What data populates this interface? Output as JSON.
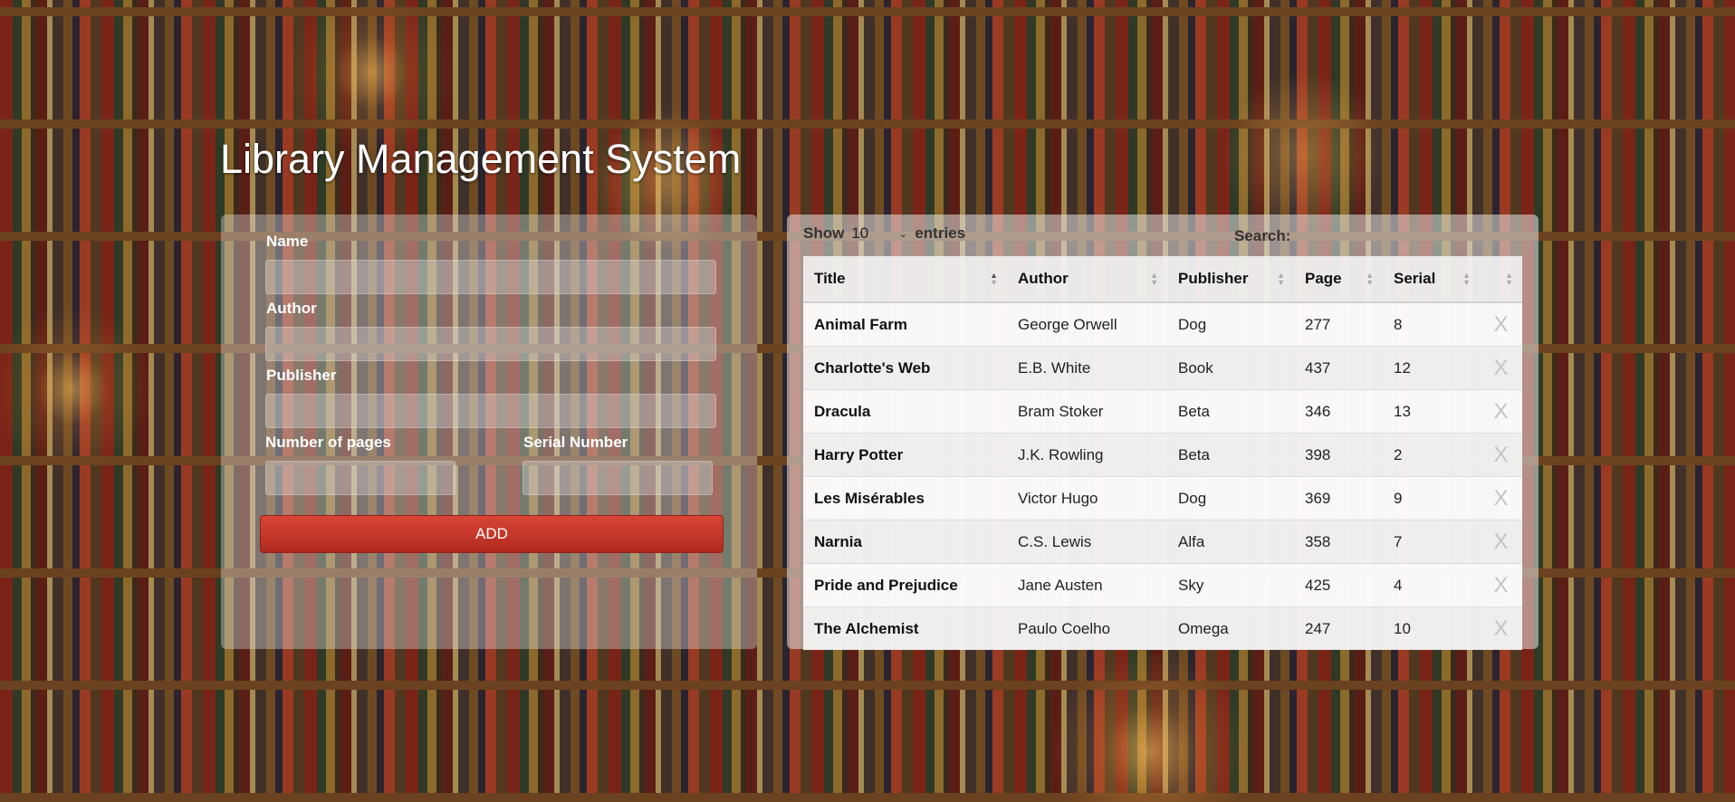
{
  "app": {
    "title": "Library Management System"
  },
  "form": {
    "name_label": "Name",
    "author_label": "Author",
    "publisher_label": "Publisher",
    "pages_label": "Number of pages",
    "serial_label": "Serial Number",
    "add_button": "ADD"
  },
  "table_controls": {
    "show_label": "Show",
    "entries_value": "10",
    "entries_label": "entries",
    "search_label": "Search:"
  },
  "table": {
    "columns": [
      "Title",
      "Author",
      "Publisher",
      "Page",
      "Serial"
    ],
    "delete_label": "X",
    "rows": [
      {
        "title": "Animal Farm",
        "author": "George Orwell",
        "publisher": "Dog",
        "page": "277",
        "serial": "8"
      },
      {
        "title": "Charlotte's Web",
        "author": "E.B. White",
        "publisher": "Book",
        "page": "437",
        "serial": "12"
      },
      {
        "title": "Dracula",
        "author": "Bram Stoker",
        "publisher": "Beta",
        "page": "346",
        "serial": "13"
      },
      {
        "title": "Harry Potter",
        "author": "J.K. Rowling",
        "publisher": "Beta",
        "page": "398",
        "serial": "2"
      },
      {
        "title": "Les Misérables",
        "author": "Victor Hugo",
        "publisher": "Dog",
        "page": "369",
        "serial": "9"
      },
      {
        "title": "Narnia",
        "author": "C.S. Lewis",
        "publisher": "Alfa",
        "page": "358",
        "serial": "7"
      },
      {
        "title": "Pride and Prejudice",
        "author": "Jane Austen",
        "publisher": "Sky",
        "page": "425",
        "serial": "4"
      },
      {
        "title": "The Alchemist",
        "author": "Paulo Coelho",
        "publisher": "Omega",
        "page": "247",
        "serial": "10"
      }
    ]
  }
}
